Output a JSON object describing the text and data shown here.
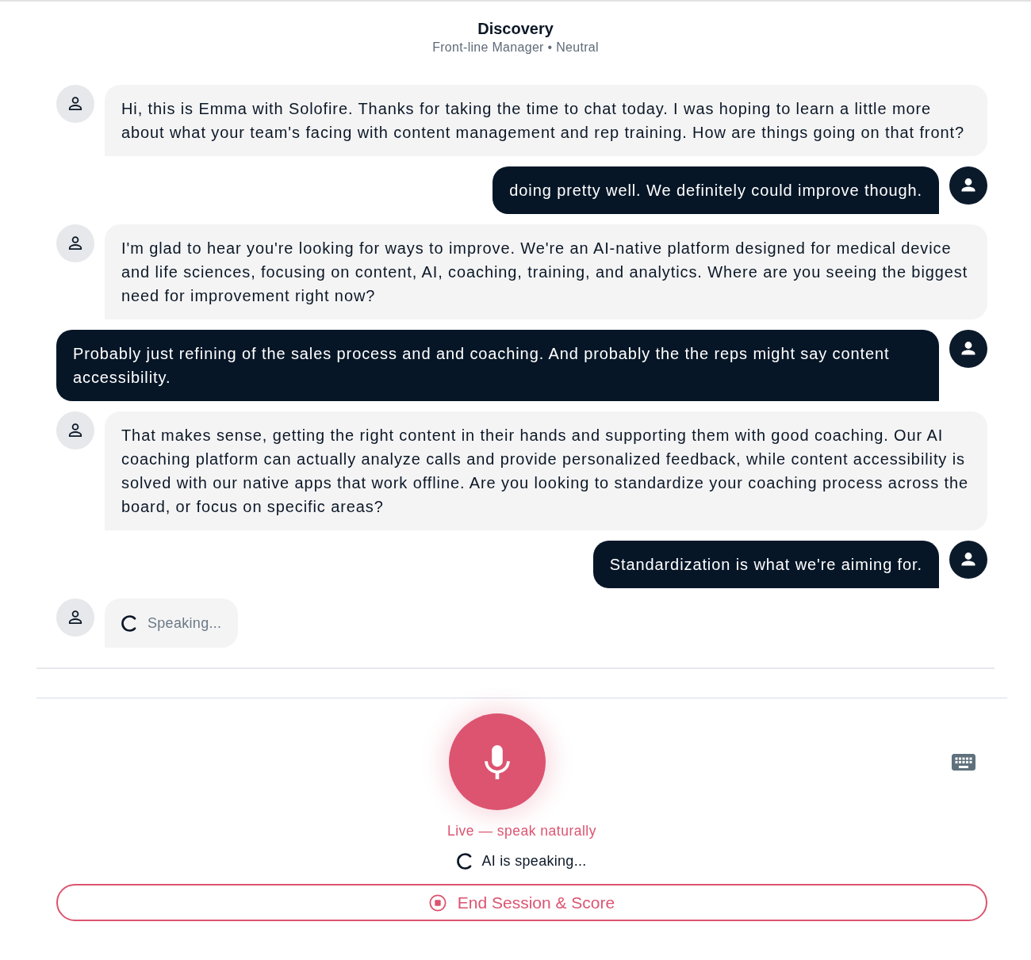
{
  "header": {
    "title": "Discovery",
    "subtitle": "Front-line Manager • Neutral"
  },
  "messages": [
    {
      "kind": "assistant",
      "text": "Hi, this is Emma with Solofire. Thanks for taking the time to chat today. I was hoping to learn a little more about what your team's facing with content management and rep training. How are things going on that front?"
    },
    {
      "kind": "user",
      "text": "doing pretty well. We definitely could improve though."
    },
    {
      "kind": "assistant",
      "text": "I'm glad to hear you're looking for ways to improve. We're an AI-native platform designed for medical device and life sciences, focusing on content, AI, coaching, training, and analytics. Where are you seeing the biggest need for improvement right now?"
    },
    {
      "kind": "user",
      "text": "Probably just refining of the sales process and and coaching. And probably the the reps might say content accessibility."
    },
    {
      "kind": "assistant",
      "text": "That makes sense, getting the right content in their hands and supporting them with good coaching. Our AI coaching platform can actually analyze calls and provide personalized feedback, while content accessibility is solved with our native apps that work offline. Are you looking to standardize your coaching process across the board, or focus on specific areas?"
    },
    {
      "kind": "user",
      "text": "Standardization is what we're aiming for."
    },
    {
      "kind": "typing",
      "text": "Speaking..."
    }
  ],
  "voice": {
    "active": true,
    "status": "Live — speak naturally",
    "activity": "AI is speaking..."
  },
  "end_button": {
    "label": "End Session & Score"
  }
}
